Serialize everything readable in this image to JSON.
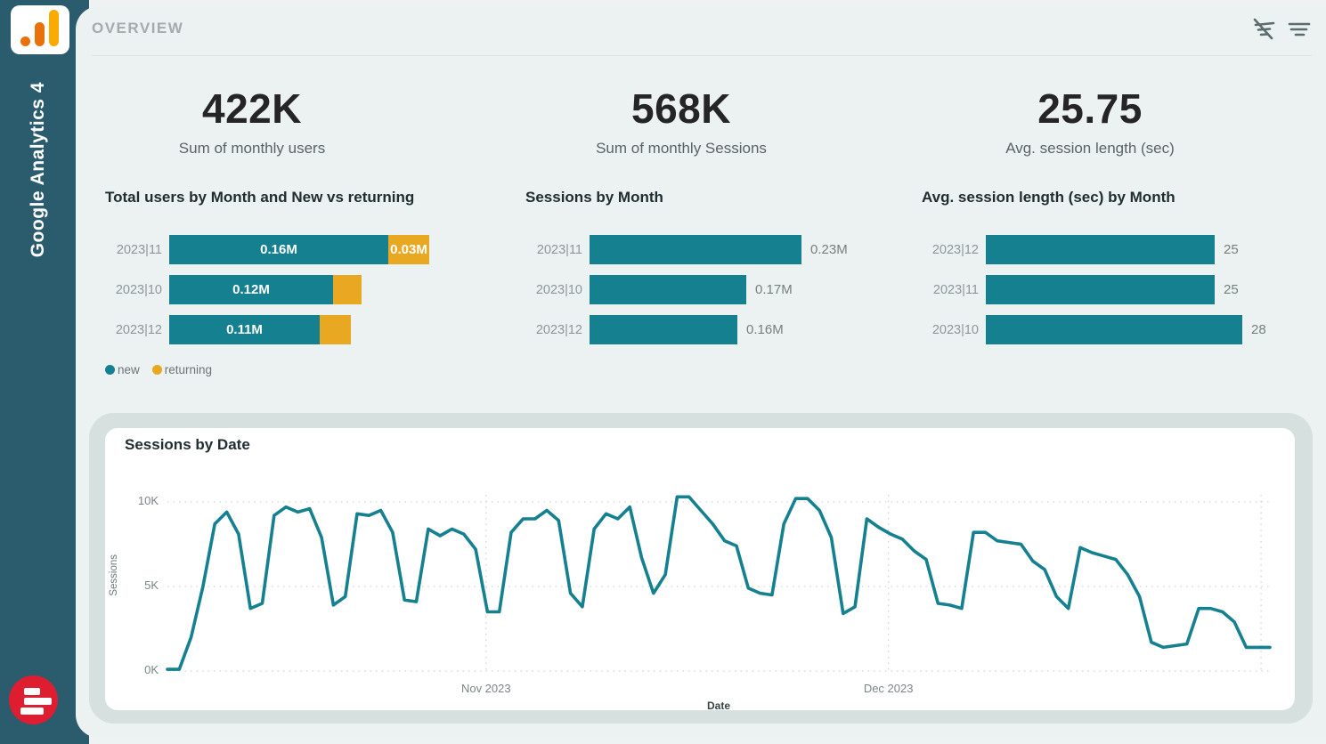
{
  "sidebar": {
    "title": "Google Analytics 4",
    "logo": "google-analytics-logo",
    "bottom_logo": "red-bars-logo"
  },
  "header": {
    "title": "OVERVIEW",
    "icons": [
      "filter-off-icon",
      "filter-icon"
    ]
  },
  "kpis": [
    {
      "value": "422K",
      "label": "Sum of monthly users"
    },
    {
      "value": "568K",
      "label": "Sum of monthly Sessions"
    },
    {
      "value": "25.75",
      "label": "Avg. session length (sec)"
    }
  ],
  "colors": {
    "teal": "#15808f",
    "yellow": "#e9a822",
    "sidebar": "#2b5c6d",
    "logo_red": "#df1d31",
    "logo_orange": "#e8710a",
    "logo_amber": "#f9ab00",
    "grid": "#cfd6d6"
  },
  "chart_data": [
    {
      "type": "bar",
      "variant": "stacked-horizontal",
      "title": "Total users by Month and New vs returning",
      "categories": [
        "2023|11",
        "2023|10",
        "2023|12"
      ],
      "series": [
        {
          "name": "new",
          "color": "#15808f",
          "values": [
            0.16,
            0.12,
            0.11
          ],
          "labels": [
            "0.16M",
            "0.12M",
            "0.11M"
          ]
        },
        {
          "name": "returning",
          "color": "#e9a822",
          "values": [
            0.03,
            0.021,
            0.023
          ],
          "labels": [
            "0.03M",
            "",
            ""
          ]
        }
      ],
      "legend": [
        {
          "label": "new",
          "color": "#15808f"
        },
        {
          "label": "returning",
          "color": "#e9a822"
        }
      ],
      "xmax": 0.19,
      "unit": "M users"
    },
    {
      "type": "bar",
      "variant": "horizontal",
      "title": "Sessions by Month",
      "categories": [
        "2023|11",
        "2023|10",
        "2023|12"
      ],
      "values": [
        0.23,
        0.17,
        0.16
      ],
      "labels": [
        "0.23M",
        "0.17M",
        "0.16M"
      ],
      "xmax": 0.23,
      "unit": "M sessions"
    },
    {
      "type": "bar",
      "variant": "horizontal",
      "title": "Avg. session length (sec) by Month",
      "categories": [
        "2023|12",
        "2023|11",
        "2023|10"
      ],
      "values": [
        25,
        25,
        28
      ],
      "labels": [
        "25",
        "25",
        "28"
      ],
      "xmax": 28,
      "unit": "sec"
    },
    {
      "type": "line",
      "title": "Sessions by Date",
      "xlabel": "Date",
      "ylabel": "Sessions",
      "y_ticks": [
        {
          "label": "0K",
          "value": 0
        },
        {
          "label": "5K",
          "value": 5
        },
        {
          "label": "10K",
          "value": 10
        }
      ],
      "ylim": [
        0,
        11
      ],
      "x_ticks": [
        {
          "label": "Nov 2023",
          "frac": 0.289
        },
        {
          "label": "Dec 2023",
          "frac": 0.654
        }
      ],
      "x_grid_fracs": [
        0.289,
        0.654,
        0.992
      ],
      "unit": "K sessions per day",
      "values": [
        0.1,
        0.1,
        2.0,
        5.0,
        8.7,
        9.4,
        8.1,
        3.7,
        4.0,
        9.2,
        9.7,
        9.4,
        9.6,
        7.9,
        3.9,
        4.4,
        9.3,
        9.2,
        9.5,
        8.2,
        4.2,
        4.1,
        8.4,
        8.0,
        8.4,
        8.1,
        7.2,
        3.5,
        3.5,
        8.2,
        9.0,
        9.0,
        9.5,
        8.9,
        4.6,
        3.8,
        8.4,
        9.3,
        9.0,
        9.7,
        6.7,
        4.6,
        5.7,
        10.3,
        10.3,
        9.5,
        8.7,
        7.7,
        7.4,
        4.9,
        4.6,
        4.5,
        8.7,
        10.2,
        10.2,
        9.5,
        7.9,
        3.4,
        3.8,
        9.0,
        8.5,
        8.1,
        7.8,
        7.1,
        6.6,
        4.0,
        3.9,
        3.7,
        8.2,
        8.2,
        7.7,
        7.6,
        7.5,
        6.5,
        6.0,
        4.4,
        3.7,
        7.3,
        7.0,
        6.8,
        6.6,
        5.7,
        4.4,
        1.7,
        1.4,
        1.5,
        1.6,
        3.7,
        3.7,
        3.5,
        2.9,
        1.4,
        1.4,
        1.4
      ]
    }
  ]
}
